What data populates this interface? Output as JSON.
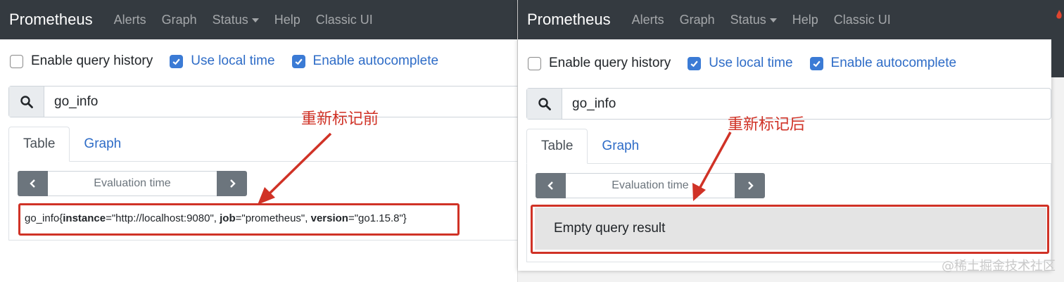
{
  "panels": [
    {
      "navbar": {
        "brand": "Prometheus",
        "links": [
          "Alerts",
          "Graph",
          "Status",
          "Help",
          "Classic UI"
        ]
      },
      "options": [
        {
          "label": "Enable query history",
          "checked": false
        },
        {
          "label": "Use local time",
          "checked": true
        },
        {
          "label": "Enable autocomplete",
          "checked": true
        }
      ],
      "search": {
        "value": "go_info"
      },
      "tabs": [
        "Table",
        "Graph"
      ],
      "eval_label": "Evaluation time",
      "annotation": "重新标记前"
    },
    {
      "navbar": {
        "brand": "Prometheus",
        "links": [
          "Alerts",
          "Graph",
          "Status",
          "Help",
          "Classic UI"
        ]
      },
      "options": [
        {
          "label": "Enable query history",
          "checked": false
        },
        {
          "label": "Use local time",
          "checked": true
        },
        {
          "label": "Enable autocomplete",
          "checked": true
        }
      ],
      "search": {
        "value": "go_info"
      },
      "tabs": [
        "Table",
        "Graph"
      ],
      "eval_label": "Evaluation time",
      "annotation": "重新标记后",
      "empty_result": "Empty query result"
    }
  ],
  "result": {
    "metric": "go_info",
    "open": "{",
    "labels": [
      {
        "key": "instance",
        "value": "\"http://localhost:9080\"",
        "sep": ", "
      },
      {
        "key": "job",
        "value": "\"prometheus\"",
        "sep": ", "
      },
      {
        "key": "version",
        "value": "\"go1.15.8\"",
        "sep": ""
      }
    ],
    "close": "}"
  },
  "watermark": "@稀土掘金技术社区",
  "colors": {
    "navbar": "#343a40",
    "link": "#2e6cc7",
    "annotation": "#d03226",
    "checkbox": "#3b7bd5"
  }
}
